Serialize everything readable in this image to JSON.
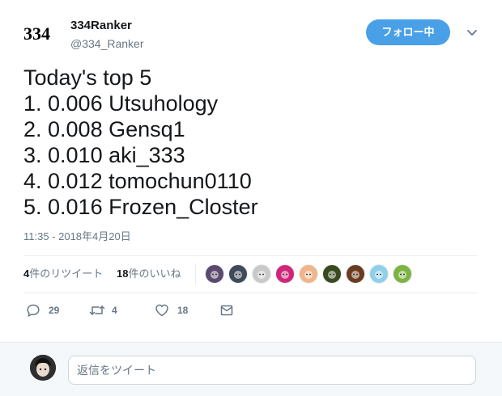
{
  "user": {
    "avatar_text": "334",
    "display_name": "334Ranker",
    "screen_name": "@334_Ranker"
  },
  "follow_button_label": "フォロー中",
  "tweet": {
    "lines": [
      "Today's top 5",
      "1. 0.006 Utsuhology",
      "2. 0.008 Gensq1",
      "3. 0.010 aki_333",
      "4. 0.012 tomochun0110",
      "5. 0.016 Frozen_Closter"
    ],
    "timestamp": "11:35 - 2018年4月20日"
  },
  "stats": {
    "retweet_count": "4",
    "retweet_label": "件のリツイート",
    "like_count": "18",
    "like_label": "件のいいね"
  },
  "likers": [
    {
      "name": "liker-1",
      "color": "#5b4a6e"
    },
    {
      "name": "liker-2",
      "color": "#3f4a5a"
    },
    {
      "name": "liker-3",
      "color": "#c9c9c9"
    },
    {
      "name": "liker-4",
      "color": "#d0257a"
    },
    {
      "name": "liker-5",
      "color": "#f0b58a"
    },
    {
      "name": "liker-6",
      "color": "#3a4a1e"
    },
    {
      "name": "liker-7",
      "color": "#6a3b1f"
    },
    {
      "name": "liker-8",
      "color": "#8fd0e8"
    },
    {
      "name": "liker-9",
      "color": "#7cb342"
    }
  ],
  "actions": {
    "reply_count": "29",
    "retweet_count": "4",
    "like_count": "18"
  },
  "reply": {
    "placeholder": "返信をツイート"
  },
  "colors": {
    "accent": "#4aa0e6",
    "muted": "#657786",
    "text": "#14171a"
  }
}
